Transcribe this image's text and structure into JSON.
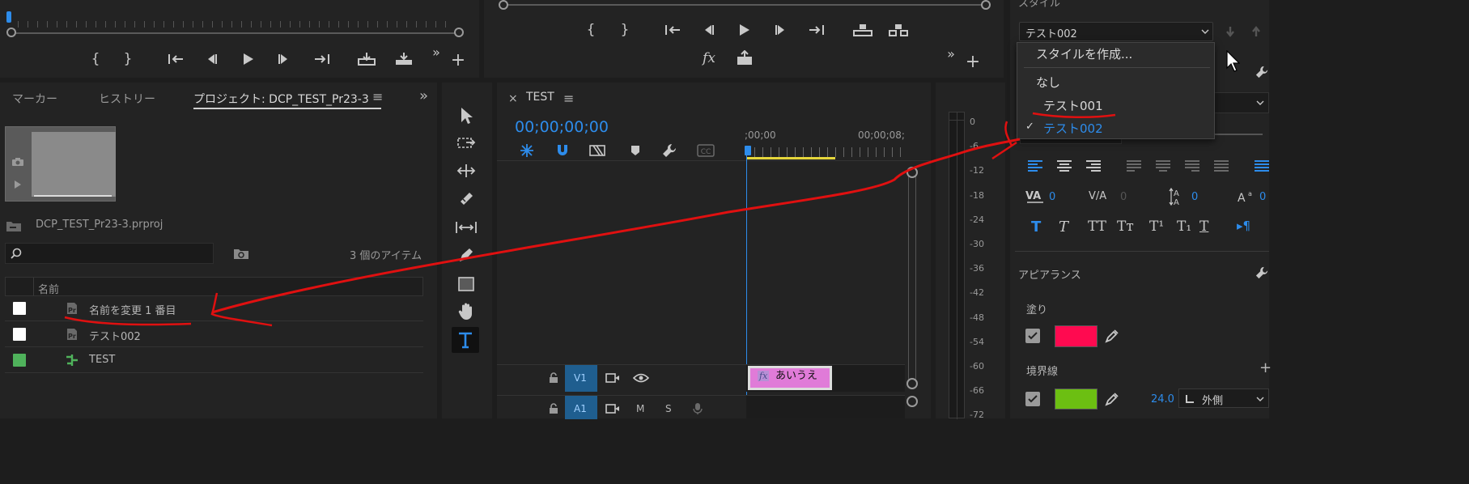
{
  "source_monitor": {
    "transport": [
      "{",
      "}",
      "{←",
      "◀|",
      "▶",
      "|▶",
      "→}",
      "insert",
      "overwrite"
    ],
    "more": "»",
    "add": "+"
  },
  "program_monitor": {
    "transport": [
      "{",
      "}",
      "{←",
      "◀|",
      "▶",
      "|▶",
      "→}",
      "lift",
      "extract"
    ],
    "fx": "fx",
    "export_frame": "export",
    "more": "»",
    "add": "+"
  },
  "project_panel": {
    "tabs": [
      "マーカー",
      "ヒストリー",
      "プロジェクト: DCP_TEST_Pr23-3"
    ],
    "menu_glyph": "≡",
    "more": "»",
    "filename": "DCP_TEST_Pr23-3.prproj",
    "item_count": "3 個のアイテム",
    "search_placeholder": "",
    "column_name": "名前",
    "items": [
      {
        "name": "名前を変更 1 番目",
        "label_color": "#ffffff",
        "icon": "premiere-graphic-icon"
      },
      {
        "name": "テスト002",
        "label_color": "#ffffff",
        "icon": "premiere-graphic-icon"
      },
      {
        "name": "TEST",
        "label_color": "#4fb25b",
        "icon": "sequence-icon"
      }
    ]
  },
  "timeline": {
    "close": "×",
    "title": "TEST",
    "menu_glyph": "≡",
    "timecode": "00;00;00;00",
    "ruler_labels": [
      ";00;00",
      "00;00;08;"
    ],
    "tracks": [
      {
        "name": "V1",
        "buttons": [
          "lock",
          "film",
          "eye"
        ]
      },
      {
        "name": "A1",
        "buttons": [
          "lock",
          "film",
          "M",
          "S",
          "mic"
        ]
      }
    ],
    "clip": {
      "fx": "fx",
      "label": "あいうえ"
    }
  },
  "audio_meter": {
    "labels": [
      "0",
      "-6",
      "-12",
      "-18",
      "-24",
      "-30",
      "-36",
      "-42",
      "-48",
      "-54",
      "-60",
      "-66",
      "-72"
    ]
  },
  "essential_graphics": {
    "section_title": "スタイル",
    "style_value": "テスト002",
    "dropdown": {
      "items": [
        "スタイルを作成...",
        "なし",
        "テスト001",
        "テスト002"
      ],
      "selected": "テスト002"
    },
    "tracking_values": [
      "0",
      "0",
      "0",
      "0"
    ],
    "appearance_title": "アピアランス",
    "fill_label": "塗り",
    "fill_color": "#ff0a50",
    "stroke_label": "境界線",
    "stroke_color": "#6cbf12",
    "stroke_width": "24.0",
    "stroke_position": "外側"
  },
  "colors": {
    "accent": "#2d8ceb",
    "annotation": "#e01010",
    "clip": "#e07bd8",
    "work_area": "#e5d63b"
  }
}
